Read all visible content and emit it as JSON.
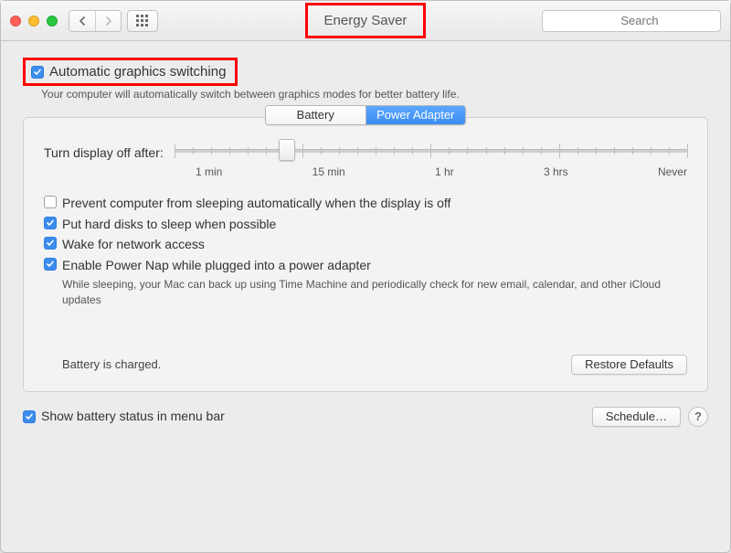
{
  "window": {
    "title": "Energy Saver",
    "search_placeholder": "Search"
  },
  "auto_graphics": {
    "label": "Automatic graphics switching",
    "checked": true,
    "description": "Your computer will automatically switch between graphics modes for better battery life."
  },
  "tabs": {
    "battery": "Battery",
    "power_adapter": "Power Adapter",
    "active": "power_adapter"
  },
  "slider": {
    "label": "Turn display off after:",
    "ticks": [
      "1 min",
      "15 min",
      "1 hr",
      "3 hrs",
      "Never"
    ],
    "value_position_pct": 22
  },
  "options": [
    {
      "label": "Prevent computer from sleeping automatically when the display is off",
      "checked": false
    },
    {
      "label": "Put hard disks to sleep when possible",
      "checked": true
    },
    {
      "label": "Wake for network access",
      "checked": true
    },
    {
      "label": "Enable Power Nap while plugged into a power adapter",
      "checked": true,
      "hint": "While sleeping, your Mac can back up using Time Machine and periodically check for new email, calendar, and other iCloud updates"
    }
  ],
  "status_text": "Battery is charged.",
  "buttons": {
    "restore_defaults": "Restore Defaults",
    "schedule": "Schedule…"
  },
  "bottom_checkbox": {
    "label": "Show battery status in menu bar",
    "checked": true
  },
  "help_label": "?"
}
